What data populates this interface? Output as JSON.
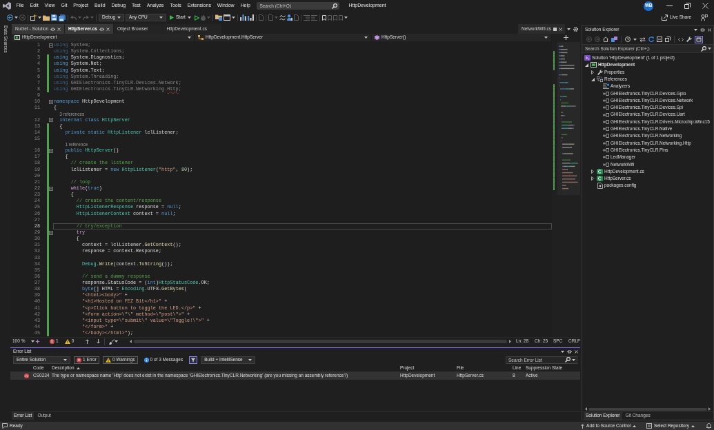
{
  "window": {
    "title": "HttpDevelopment",
    "avatar": "WB"
  },
  "menu": [
    "File",
    "Edit",
    "View",
    "Git",
    "Project",
    "Build",
    "Debug",
    "Test",
    "Analyze",
    "Tools",
    "Extensions",
    "Window",
    "Help"
  ],
  "search": {
    "placeholder": "Search (Ctrl+Q)"
  },
  "toolbar": {
    "configuration": "Debug",
    "platform": "Any CPU",
    "start": "Start",
    "live_share": "Live Share"
  },
  "side_strip": {
    "label": "Data Sources"
  },
  "editor": {
    "tabs": [
      {
        "label": "NuGet - Solution",
        "selected": false,
        "highlighted": true
      },
      {
        "label": "HttpServer.cs",
        "selected": true,
        "highlighted": true
      },
      {
        "label": "Object Browser",
        "selected": false,
        "highlighted": false
      },
      {
        "label": "HttpDevelopment.cs",
        "selected": false,
        "highlighted": false
      }
    ],
    "preview_tab": {
      "label": "NetworkWifi.cs"
    },
    "navigation": [
      {
        "kind": "project",
        "label": "HttpDevelopment"
      },
      {
        "kind": "class",
        "label": "HttpDevelopment.HttpServer"
      },
      {
        "kind": "method",
        "label": "HttpServer()"
      }
    ],
    "lines": [
      {
        "kind": "code",
        "number": "1",
        "changed": false,
        "collapsible": true,
        "dimmed": true,
        "current": false,
        "tokens": [
          {
            "kind": "keyword",
            "text": "using"
          },
          {
            "kind": "plain",
            "text": " System;"
          }
        ]
      },
      {
        "kind": "code",
        "number": "2",
        "changed": false,
        "collapsible": false,
        "dimmed": true,
        "current": false,
        "tokens": [
          {
            "kind": "keyword",
            "text": "using"
          },
          {
            "kind": "plain",
            "text": " System.Collections;"
          }
        ]
      },
      {
        "kind": "code",
        "number": "3",
        "changed": true,
        "collapsible": false,
        "dimmed": false,
        "current": false,
        "tokens": [
          {
            "kind": "keyword",
            "text": "using"
          },
          {
            "kind": "plain",
            "text": " System.Diagnostics;"
          }
        ]
      },
      {
        "kind": "code",
        "number": "4",
        "changed": true,
        "collapsible": false,
        "dimmed": false,
        "current": false,
        "tokens": [
          {
            "kind": "keyword",
            "text": "using"
          },
          {
            "kind": "plain",
            "text": " System.Net;"
          }
        ]
      },
      {
        "kind": "code",
        "number": "5",
        "changed": true,
        "collapsible": false,
        "dimmed": false,
        "current": false,
        "tokens": [
          {
            "kind": "keyword",
            "text": "using"
          },
          {
            "kind": "plain",
            "text": " System.Text;"
          }
        ]
      },
      {
        "kind": "code",
        "number": "6",
        "changed": true,
        "collapsible": false,
        "dimmed": true,
        "current": false,
        "tokens": [
          {
            "kind": "keyword",
            "text": "using"
          },
          {
            "kind": "plain",
            "text": " System.Threading;"
          }
        ]
      },
      {
        "kind": "code",
        "number": "7",
        "changed": true,
        "collapsible": false,
        "dimmed": true,
        "current": false,
        "tokens": [
          {
            "kind": "keyword",
            "text": "using"
          },
          {
            "kind": "plain",
            "text": " GHIElectronics.TinyCLR.Devices.Network;"
          }
        ]
      },
      {
        "kind": "code",
        "number": "8",
        "changed": true,
        "collapsible": false,
        "dimmed": true,
        "current": false,
        "tokens": [
          {
            "kind": "keyword",
            "text": "using"
          },
          {
            "kind": "plain",
            "text": " GHIElectronics.TinyCLR.Networking."
          },
          {
            "kind": "error",
            "text": "Http"
          },
          {
            "kind": "plain",
            "text": ";"
          }
        ]
      },
      {
        "kind": "code",
        "number": "9",
        "changed": false,
        "collapsible": false,
        "current": false
      },
      {
        "kind": "code",
        "number": "10",
        "changed": false,
        "collapsible": true,
        "dimmed": false,
        "current": false,
        "tokens": [
          {
            "kind": "keyword",
            "text": "namespace"
          },
          {
            "kind": "plain",
            "text": " HttpDevelopment"
          }
        ]
      },
      {
        "kind": "code",
        "number": "11",
        "changed": false,
        "collapsible": false,
        "dimmed": false,
        "current": false,
        "tokens": [
          {
            "kind": "plain",
            "text": "{"
          }
        ]
      },
      {
        "kind": "codelens",
        "text": "  3 references",
        "changed": false
      },
      {
        "kind": "code",
        "number": "12",
        "changed": false,
        "collapsible": true,
        "dimmed": false,
        "current": false,
        "tokens": [
          {
            "kind": "keyword",
            "text": "  internal class "
          },
          {
            "kind": "type",
            "text": "HttpServer"
          }
        ]
      },
      {
        "kind": "code",
        "number": "13",
        "changed": true,
        "collapsible": false,
        "dimmed": false,
        "current": false,
        "tokens": [
          {
            "kind": "plain",
            "text": "  {"
          }
        ]
      },
      {
        "kind": "code",
        "number": "14",
        "changed": true,
        "collapsible": false,
        "dimmed": false,
        "current": false,
        "tokens": [
          {
            "kind": "keyword",
            "text": "    private static "
          },
          {
            "kind": "type",
            "text": "HttpListener"
          },
          {
            "kind": "plain",
            "text": " lclListener;"
          }
        ]
      },
      {
        "kind": "code",
        "number": "15",
        "changed": true,
        "collapsible": false,
        "current": false
      },
      {
        "kind": "codelens",
        "text": "    1 reference",
        "changed": true
      },
      {
        "kind": "code",
        "number": "16",
        "changed": true,
        "collapsible": true,
        "dimmed": false,
        "current": false,
        "tokens": [
          {
            "kind": "keyword",
            "text": "    public "
          },
          {
            "kind": "type",
            "text": "HttpServer"
          },
          {
            "kind": "plain",
            "text": "()"
          }
        ]
      },
      {
        "kind": "code",
        "number": "17",
        "changed": true,
        "collapsible": false,
        "dimmed": false,
        "current": false,
        "tokens": [
          {
            "kind": "plain",
            "text": "    {"
          }
        ]
      },
      {
        "kind": "code",
        "number": "18",
        "changed": true,
        "collapsible": false,
        "dimmed": false,
        "current": false,
        "tokens": [
          {
            "kind": "comment",
            "text": "      // create the listener"
          }
        ]
      },
      {
        "kind": "code",
        "number": "19",
        "changed": true,
        "collapsible": false,
        "dimmed": false,
        "current": false,
        "tokens": [
          {
            "kind": "plain",
            "text": "      lclListener = "
          },
          {
            "kind": "keyword",
            "text": "new "
          },
          {
            "kind": "type",
            "text": "HttpListener"
          },
          {
            "kind": "plain",
            "text": "("
          },
          {
            "kind": "string",
            "text": "\"http\""
          },
          {
            "kind": "plain",
            "text": ", "
          },
          {
            "kind": "number",
            "text": "80"
          },
          {
            "kind": "plain",
            "text": ");"
          }
        ]
      },
      {
        "kind": "code",
        "number": "20",
        "changed": true,
        "collapsible": false,
        "current": false
      },
      {
        "kind": "code",
        "number": "21",
        "changed": true,
        "collapsible": false,
        "dimmed": false,
        "current": false,
        "tokens": [
          {
            "kind": "comment",
            "text": "      // loop"
          }
        ]
      },
      {
        "kind": "code",
        "number": "22",
        "changed": true,
        "collapsible": true,
        "dimmed": false,
        "current": false,
        "tokens": [
          {
            "kind": "control",
            "text": "      while"
          },
          {
            "kind": "plain",
            "text": "("
          },
          {
            "kind": "keyword",
            "text": "true"
          },
          {
            "kind": "plain",
            "text": ")"
          }
        ]
      },
      {
        "kind": "code",
        "number": "23",
        "changed": true,
        "collapsible": false,
        "dimmed": false,
        "current": false,
        "tokens": [
          {
            "kind": "plain",
            "text": "      {"
          }
        ]
      },
      {
        "kind": "code",
        "number": "24",
        "changed": true,
        "collapsible": false,
        "dimmed": false,
        "current": false,
        "tokens": [
          {
            "kind": "comment",
            "text": "        // create the content/response"
          }
        ]
      },
      {
        "kind": "code",
        "number": "25",
        "changed": true,
        "collapsible": false,
        "dimmed": false,
        "current": false,
        "tokens": [
          {
            "kind": "type",
            "text": "        HttpListenerResponse"
          },
          {
            "kind": "plain",
            "text": " response = "
          },
          {
            "kind": "keyword",
            "text": "null"
          },
          {
            "kind": "plain",
            "text": ";"
          }
        ]
      },
      {
        "kind": "code",
        "number": "26",
        "changed": true,
        "collapsible": false,
        "dimmed": false,
        "current": false,
        "tokens": [
          {
            "kind": "type",
            "text": "        HttpListenerContext"
          },
          {
            "kind": "plain",
            "text": " context = "
          },
          {
            "kind": "keyword",
            "text": "null"
          },
          {
            "kind": "plain",
            "text": ";"
          }
        ]
      },
      {
        "kind": "code",
        "number": "27",
        "changed": true,
        "collapsible": false,
        "current": false
      },
      {
        "kind": "code",
        "number": "28",
        "changed": true,
        "collapsible": false,
        "dimmed": false,
        "current": true,
        "tokens": [
          {
            "kind": "comment",
            "text": "        // try/exception"
          }
        ]
      },
      {
        "kind": "code",
        "number": "29",
        "changed": true,
        "collapsible": true,
        "dimmed": false,
        "current": false,
        "tokens": [
          {
            "kind": "control",
            "text": "        try"
          }
        ]
      },
      {
        "kind": "code",
        "number": "30",
        "changed": true,
        "collapsible": false,
        "dimmed": false,
        "current": false,
        "tokens": [
          {
            "kind": "plain",
            "text": "        {"
          }
        ]
      },
      {
        "kind": "code",
        "number": "31",
        "changed": true,
        "collapsible": false,
        "dimmed": false,
        "current": false,
        "tokens": [
          {
            "kind": "plain",
            "text": "          context = lclListener."
          },
          {
            "kind": "method",
            "text": "GetContext"
          },
          {
            "kind": "plain",
            "text": "();"
          }
        ]
      },
      {
        "kind": "code",
        "number": "32",
        "changed": true,
        "collapsible": false,
        "dimmed": false,
        "current": false,
        "tokens": [
          {
            "kind": "plain",
            "text": "          response = context.Response;"
          }
        ]
      },
      {
        "kind": "code",
        "number": "33",
        "changed": true,
        "collapsible": false,
        "current": false
      },
      {
        "kind": "code",
        "number": "34",
        "changed": true,
        "collapsible": false,
        "dimmed": false,
        "current": false,
        "tokens": [
          {
            "kind": "type",
            "text": "          Debug"
          },
          {
            "kind": "plain",
            "text": "."
          },
          {
            "kind": "method",
            "text": "Write"
          },
          {
            "kind": "plain",
            "text": "(context."
          },
          {
            "kind": "method",
            "text": "ToString"
          },
          {
            "kind": "plain",
            "text": "());"
          }
        ]
      },
      {
        "kind": "code",
        "number": "35",
        "changed": true,
        "collapsible": false,
        "current": false
      },
      {
        "kind": "code",
        "number": "36",
        "changed": true,
        "collapsible": false,
        "dimmed": false,
        "current": false,
        "tokens": [
          {
            "kind": "comment",
            "text": "          // send a dummy response"
          }
        ]
      },
      {
        "kind": "code",
        "number": "37",
        "changed": true,
        "collapsible": false,
        "dimmed": false,
        "current": false,
        "tokens": [
          {
            "kind": "plain",
            "text": "          response.StatusCode = ("
          },
          {
            "kind": "keyword",
            "text": "int"
          },
          {
            "kind": "plain",
            "text": ")"
          },
          {
            "kind": "type",
            "text": "HttpStatusCode"
          },
          {
            "kind": "plain",
            "text": ".OK;"
          }
        ]
      },
      {
        "kind": "code",
        "number": "38",
        "changed": true,
        "collapsible": false,
        "dimmed": false,
        "current": false,
        "tokens": [
          {
            "kind": "keyword",
            "text": "          byte"
          },
          {
            "kind": "plain",
            "text": "[] HTML = "
          },
          {
            "kind": "type",
            "text": "Encoding"
          },
          {
            "kind": "plain",
            "text": ".UTF8."
          },
          {
            "kind": "method",
            "text": "GetBytes"
          },
          {
            "kind": "plain",
            "text": "("
          }
        ]
      },
      {
        "kind": "code",
        "number": "39",
        "changed": true,
        "collapsible": false,
        "dimmed": false,
        "current": false,
        "tokens": [
          {
            "kind": "string",
            "text": "          \"<html><body>\""
          },
          {
            "kind": "plain",
            "text": " +"
          }
        ]
      },
      {
        "kind": "code",
        "number": "40",
        "changed": true,
        "collapsible": false,
        "dimmed": false,
        "current": false,
        "tokens": [
          {
            "kind": "string",
            "text": "          \"<h1>Hosted on FEZ Bit</h1>\""
          },
          {
            "kind": "plain",
            "text": " +"
          }
        ]
      },
      {
        "kind": "code",
        "number": "41",
        "changed": true,
        "collapsible": false,
        "dimmed": false,
        "current": false,
        "tokens": [
          {
            "kind": "string",
            "text": "          \"<p>Click button to toggle the LED.</p>\""
          },
          {
            "kind": "plain",
            "text": " +"
          }
        ]
      },
      {
        "kind": "code",
        "number": "42",
        "changed": true,
        "collapsible": false,
        "dimmed": false,
        "current": false,
        "tokens": [
          {
            "kind": "string",
            "text": "          \"<form action=\\\"\\\" method=\\\"post\\\">\""
          },
          {
            "kind": "plain",
            "text": " +"
          }
        ]
      },
      {
        "kind": "code",
        "number": "43",
        "changed": true,
        "collapsible": false,
        "dimmed": false,
        "current": false,
        "tokens": [
          {
            "kind": "string",
            "text": "          \"<input type=\\\"submit\\\" value=\\\"Toggle!\\\">\""
          },
          {
            "kind": "plain",
            "text": " +"
          }
        ]
      },
      {
        "kind": "code",
        "number": "44",
        "changed": true,
        "collapsible": false,
        "dimmed": false,
        "current": false,
        "tokens": [
          {
            "kind": "string",
            "text": "          \"</form>\""
          },
          {
            "kind": "plain",
            "text": " +"
          }
        ]
      },
      {
        "kind": "code",
        "number": "45",
        "changed": true,
        "collapsible": false,
        "dimmed": false,
        "current": false,
        "tokens": [
          {
            "kind": "string",
            "text": "          \"</body></html>\""
          },
          {
            "kind": "plain",
            "text": ");"
          }
        ]
      }
    ],
    "status": {
      "zoom": "100 %",
      "errors": "1",
      "warnings": "0",
      "line": "Ln: 28",
      "column": "Ch: 25",
      "indent": "SPC",
      "line_ending": "CRLF"
    }
  },
  "error_list": {
    "title": "Error List",
    "scope": "Entire Solution",
    "filters": [
      {
        "kind": "error",
        "label": "1 Error",
        "on": true
      },
      {
        "kind": "warning",
        "label": "0 Warnings",
        "on": true
      },
      {
        "kind": "message",
        "label": "0 of 3 Messages",
        "on": false
      }
    ],
    "filter_button": {
      "on": true
    },
    "source": "Build + IntelliSense",
    "search_placeholder": "Search Error List",
    "columns": [
      {
        "label": "Code",
        "sorted": false
      },
      {
        "label": "Description",
        "sorted": true
      },
      {
        "label": "Project",
        "sorted": false
      },
      {
        "label": "File",
        "sorted": false
      },
      {
        "label": "Line",
        "sorted": false
      },
      {
        "label": "Suppression State",
        "sorted": false
      }
    ],
    "rows": [
      {
        "kind": "error",
        "selected": true,
        "cells": [
          "CS0234",
          "The type or namespace name 'Http' does not exist in the namespace 'GHIElectronics.TinyCLR.Networking' (are you missing an assembly reference?)",
          "HttpDevelopment",
          "HttpServer.cs",
          "8",
          "Active"
        ]
      }
    ],
    "tabs": [
      {
        "label": "Error List",
        "selected": true
      },
      {
        "label": "Output",
        "selected": false
      }
    ]
  },
  "solution_explorer": {
    "title": "Solution Explorer",
    "preview_button": {
      "on": true
    },
    "search_placeholder": "Search Solution Explorer (Ctrl+;)",
    "tree": [
      {
        "kind": "solution",
        "label": "Solution 'HttpDevelopment' (1 of 1 project)",
        "children": [
          {
            "kind": "project",
            "label": "HttpDevelopment",
            "expanded": true,
            "children": [
              {
                "kind": "properties",
                "label": "Properties",
                "expanded": false
              },
              {
                "kind": "references",
                "label": "References",
                "expanded": true,
                "children": [
                  {
                    "kind": "analyzers",
                    "label": "Analyzers"
                  },
                  {
                    "kind": "reference",
                    "label": "GHIElectronics.TinyCLR.Devices.Gpio"
                  },
                  {
                    "kind": "reference",
                    "label": "GHIElectronics.TinyCLR.Devices.Network"
                  },
                  {
                    "kind": "reference",
                    "label": "GHIElectronics.TinyCLR.Devices.Spi"
                  },
                  {
                    "kind": "reference",
                    "label": "GHIElectronics.TinyCLR.Devices.Uart"
                  },
                  {
                    "kind": "reference",
                    "label": "GHIElectronics.TinyCLR.Drivers.Microchip.Winc15"
                  },
                  {
                    "kind": "reference",
                    "label": "GHIElectronics.TinyCLR.Native"
                  },
                  {
                    "kind": "reference",
                    "label": "GHIElectronics.TinyCLR.Networking"
                  },
                  {
                    "kind": "reference",
                    "label": "GHIElectronics.TinyCLR.Networking.Http"
                  },
                  {
                    "kind": "reference",
                    "label": "GHIElectronics.TinyCLR.Pins"
                  },
                  {
                    "kind": "reference",
                    "label": "LedManager"
                  },
                  {
                    "kind": "reference",
                    "label": "NetworkWifi"
                  }
                ]
              },
              {
                "kind": "csharp",
                "label": "HttpDevelopment.cs",
                "expanded": false
              },
              {
                "kind": "csharp",
                "label": "HttpServer.cs",
                "expanded": false
              },
              {
                "kind": "config",
                "label": "packages.config"
              }
            ]
          }
        ]
      }
    ],
    "tabs": [
      {
        "label": "Solution Explorer",
        "selected": true
      },
      {
        "label": "Git Changes",
        "selected": false
      }
    ]
  },
  "status_bar": {
    "text": "Ready",
    "source_control": "Add to Source Control",
    "repository": "Select Repository"
  }
}
